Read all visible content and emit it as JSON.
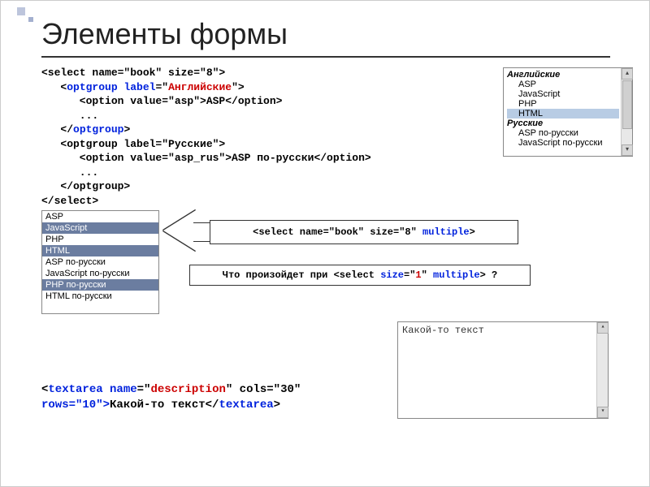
{
  "title": "Элементы формы",
  "code": {
    "l1a": "<select name=\"book\" size=\"8\">",
    "l2_pre": "   <",
    "l2_tag": "optgroup",
    "l2_lbl": " label",
    "l2_eq": "=\"",
    "l2_val": "Английские",
    "l2_post": "\">",
    "l3": "      <option value=\"asp\">ASP</option>",
    "l4": "      ...",
    "l5_pre": "   </",
    "l5_tag": "optgroup",
    "l5_post": ">",
    "l6": "   <optgroup label=\"Русские\">",
    "l7": "      <option value=\"asp_rus\">ASP по-русски</option>",
    "l8": "      ...",
    "l9": "   </optgroup>",
    "l10": "</select>"
  },
  "grouped": {
    "g1": "Английские",
    "g1items": [
      "ASP",
      "JavaScript",
      "PHP",
      "HTML"
    ],
    "g2": "Русские",
    "g2items": [
      "ASP по-русски",
      "JavaScript по-русски"
    ]
  },
  "multi": {
    "items": [
      {
        "t": "ASP",
        "sel": false
      },
      {
        "t": "JavaScript",
        "sel": true
      },
      {
        "t": "PHP",
        "sel": false
      },
      {
        "t": "HTML",
        "sel": true
      },
      {
        "t": "ASP по-русски",
        "sel": false
      },
      {
        "t": "JavaScript по-русски",
        "sel": false
      },
      {
        "t": "PHP по-русски",
        "sel": true
      },
      {
        "t": "HTML по-русски",
        "sel": false
      }
    ]
  },
  "arrow": {
    "pre": "<select name=\"book\" size=\"8\" ",
    "multiple": "multiple",
    "post": ">"
  },
  "question": {
    "pre": "Что произойдет при <select ",
    "size": "size",
    "mid1": "=\"",
    "val": "1",
    "mid2": "\" ",
    "multiple": "multiple",
    "post": "> ?"
  },
  "textarea_content": "Какой-то текст",
  "textarea_code": {
    "open1": "<",
    "tag": "textarea",
    "attrs_pre": " name",
    "eq": "=\"",
    "name_val": "description",
    "mid": "\" cols=\"30\"",
    "rows": "rows=\"10\">",
    "text": "Какой-то текст",
    "close_pre": "</",
    "close_tag": "textarea",
    "close_post": ">"
  }
}
